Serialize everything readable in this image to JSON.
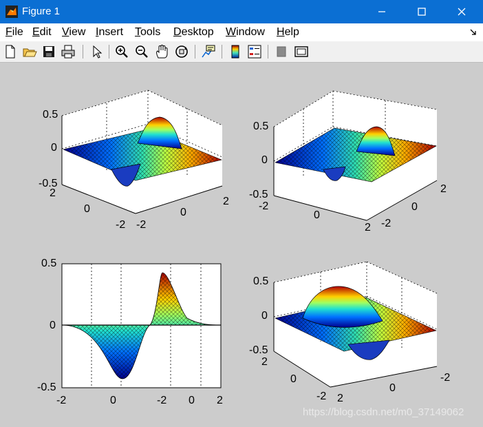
{
  "window": {
    "title": "Figure 1"
  },
  "menu": [
    "File",
    "Edit",
    "View",
    "Insert",
    "Tools",
    "Desktop",
    "Window",
    "Help"
  ],
  "toolbar_icons": [
    "new-figure-icon",
    "open-icon",
    "save-icon",
    "print-icon",
    "pointer-icon",
    "zoom-in-icon",
    "zoom-out-icon",
    "pan-icon",
    "rotate-3d-icon",
    "data-cursor-icon",
    "colorbar-icon",
    "legend-icon",
    "hide-plot-tools-icon",
    "show-plot-tools-icon"
  ],
  "subplots": [
    {
      "id": "top-left",
      "zticks": [
        "0.5",
        "0",
        "-0.5"
      ],
      "xticks": [
        "-2",
        "0",
        "2"
      ],
      "yticks": [
        "2",
        "0",
        "-2"
      ]
    },
    {
      "id": "top-right",
      "zticks": [
        "0.5",
        "0",
        "-0.5"
      ],
      "xticks": [
        "-2",
        "0",
        "2"
      ],
      "yticks": [
        "2",
        "0",
        "-2"
      ]
    },
    {
      "id": "bottom-left",
      "zticks": [
        "0.5",
        "0",
        "-0.5"
      ],
      "xticks": [
        "-2",
        "0",
        "-2",
        "0",
        "2"
      ]
    },
    {
      "id": "bottom-right",
      "zticks": [
        "0.5",
        "0",
        "-0.5"
      ],
      "xticks": [
        "2",
        "0",
        "-2"
      ],
      "yticks": [
        "-2",
        "0",
        "2"
      ]
    }
  ],
  "watermark": "https://blog.csdn.net/m0_37149062",
  "colors": {
    "titlebar": "#0b6fd3",
    "figure_bg": "#cccccc",
    "axes_bg": "#ffffff"
  }
}
